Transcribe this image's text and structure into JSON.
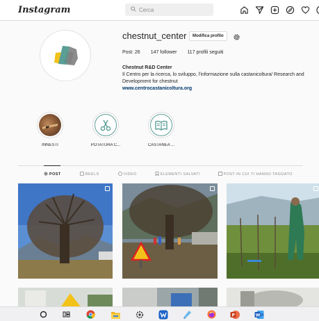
{
  "topnav": {
    "logo": "Instagram",
    "search_placeholder": "Cerca",
    "icons": [
      "home-icon",
      "send-icon",
      "add-post-icon",
      "explore-icon",
      "heart-icon",
      "profile-avatar"
    ]
  },
  "profile": {
    "username": "chestnut_center",
    "edit_label": "Modifica profilo",
    "stats": {
      "posts": "Post: 26",
      "followers": "147 follower",
      "following": "117 profili seguiti"
    },
    "display_name": "Chestnut R&D Center",
    "bio": "Il Centro per la ricerca, lo sviluppo, l'informazione sulla castanicoltura/ Research and Development for chestnut",
    "website": "www.centrocastanicoltura.org"
  },
  "highlights": [
    {
      "label": "INNESTI",
      "icon": "grafting-photo"
    },
    {
      "label": "POTATURA C...",
      "icon": "scissors-icon"
    },
    {
      "label": "CASTANEA ...",
      "icon": "book-icon"
    }
  ],
  "tabs": [
    {
      "label": "POST",
      "icon": "grid-icon",
      "active": true
    },
    {
      "label": "REELS",
      "icon": "reels-icon",
      "active": false
    },
    {
      "label": "VIDEO",
      "icon": "video-icon",
      "active": false
    },
    {
      "label": "ELEMENTI SALVATI",
      "icon": "bookmark-icon",
      "active": false
    },
    {
      "label": "POST IN CUI TI HANNO TAGGATO",
      "icon": "tag-icon",
      "active": false
    }
  ],
  "taskbar": {
    "icons": [
      "start-icon",
      "task-view-icon",
      "chrome-icon",
      "file-explorer-icon",
      "settings-icon",
      "store-icon",
      "paint-icon",
      "firefox-icon",
      "powerpoint-icon",
      "word-icon"
    ]
  },
  "colors": {
    "link": "#00376b",
    "border": "#dbdbdb",
    "muted": "#8e8e8e",
    "logo_teal": "#5a9e95",
    "logo_yellow": "#f2c21a",
    "logo_gray": "#8c8c8c"
  }
}
